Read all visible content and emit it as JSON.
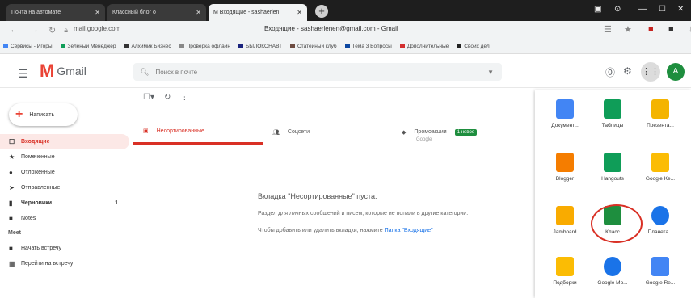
{
  "browser": {
    "tabs": [
      {
        "label": "Почта на автомате"
      },
      {
        "label": "Классный блог о"
      },
      {
        "label": "M Входящие - sashaerlen"
      }
    ],
    "new_tab": "+",
    "url": "mail.google.com",
    "page_title": "Входящие - sashaerlenen@gmail.com - Gmail"
  },
  "bookmarks": [
    {
      "label": "Сервисы - Игоры"
    },
    {
      "label": "Зелёный Менеджер"
    },
    {
      "label": "Алхимик Бизнес"
    },
    {
      "label": "Проверка офлайн"
    },
    {
      "label": "БЫЛОКОНАВТ"
    },
    {
      "label": "Статейный клуб"
    },
    {
      "label": "Тема 3 Вопросы"
    },
    {
      "label": "Дополнительные"
    },
    {
      "label": "Своих дел"
    }
  ],
  "header": {
    "logo_text": "Gmail",
    "search_placeholder": "Поиск в почте"
  },
  "compose_label": "Написать",
  "sidebar": {
    "items": [
      {
        "label": "Входящие"
      },
      {
        "label": "Помеченные"
      },
      {
        "label": "Отложенные"
      },
      {
        "label": "Отправленные"
      },
      {
        "label": "Черновики",
        "count": "1"
      },
      {
        "label": "Notes"
      }
    ],
    "meet_label": "Meet",
    "meet_items": [
      {
        "label": "Начать встречу"
      },
      {
        "label": "Перейти на встречу"
      }
    ]
  },
  "categories": [
    {
      "label": "Несортированные"
    },
    {
      "label": "Соцсети"
    },
    {
      "label": "Промоакции",
      "badge": "1 новое",
      "sub": "Google"
    }
  ],
  "empty_state": {
    "title": "Вкладка \"Несортированные\" пуста.",
    "line2": "Раздел для личных сообщений и писем, которые не попали в другие категории.",
    "line3_pre": "Чтобы добавить или удалить вкладки, нажмите",
    "line3_link": "Папка \"Входящие\""
  },
  "apps": [
    {
      "label": "Документ...",
      "color": "#4285f4"
    },
    {
      "label": "Таблицы",
      "color": "#0f9d58"
    },
    {
      "label": "Презента...",
      "color": "#f4b400"
    },
    {
      "label": "Blogger",
      "color": "#f57d00"
    },
    {
      "label": "Hangouts",
      "color": "#0f9d58"
    },
    {
      "label": "Google Ke...",
      "color": "#fbbc04"
    },
    {
      "label": "Jamboard",
      "color": "#f9ab00"
    },
    {
      "label": "Класс",
      "color": "#1e8e3e"
    },
    {
      "label": "Планета...",
      "color": "#1a73e8"
    },
    {
      "label": "Подборки",
      "color": "#fbbc04"
    },
    {
      "label": "Google Mo...",
      "color": "#1a73e8"
    },
    {
      "label": "Google Re...",
      "color": "#4285f4"
    }
  ]
}
